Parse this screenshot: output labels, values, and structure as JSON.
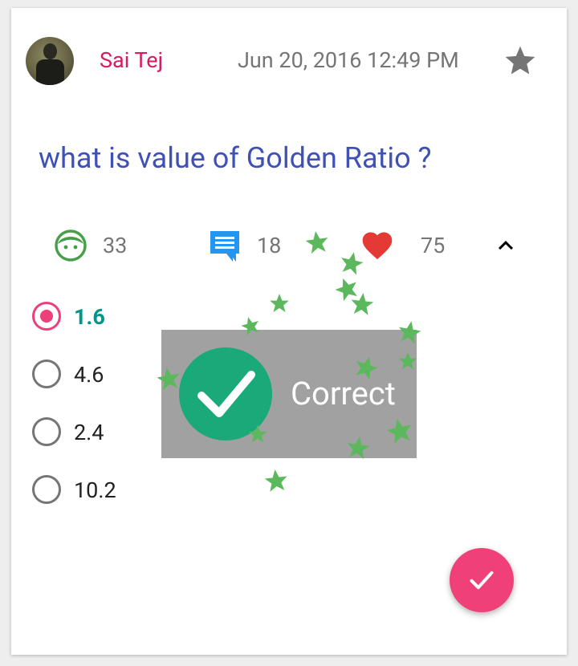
{
  "post": {
    "username": "Sai Tej",
    "timestamp": "Jun 20, 2016 12:49 PM",
    "question": "what is value of Golden Ratio ?"
  },
  "stats": {
    "views": {
      "icon": "face-icon",
      "count": "33",
      "color": "#43a047"
    },
    "comments": {
      "icon": "comment-icon",
      "count": "18",
      "color": "#2196f3"
    },
    "likes": {
      "icon": "heart-icon",
      "count": "75",
      "color": "#e53935"
    }
  },
  "options": [
    {
      "label": "1.6",
      "selected": true
    },
    {
      "label": "4.6",
      "selected": false
    },
    {
      "label": "2.4",
      "selected": false
    },
    {
      "label": "10.2",
      "selected": false
    }
  ],
  "feedback": {
    "text": "Correct",
    "icon": "checkmark-icon",
    "color": "#1aaa7a"
  },
  "colors": {
    "accent": "#ec407a",
    "username": "#d81b60",
    "question": "#3f51b5",
    "selected_option": "#009688",
    "confetti_star": "#5cb85c"
  }
}
